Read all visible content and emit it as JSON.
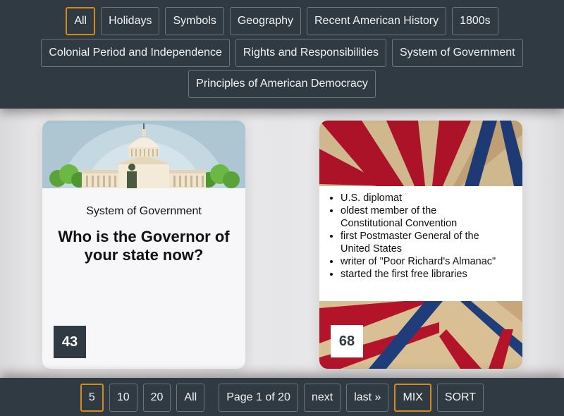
{
  "filters": {
    "row1": [
      "All",
      "Holidays",
      "Symbols",
      "Geography",
      "Recent American History",
      "1800s"
    ],
    "row2": [
      "Colonial Period and Independence",
      "Rights and Responsibilities",
      "System of Government"
    ],
    "row3": [
      "Principles of American Democracy"
    ],
    "active": "All"
  },
  "card1": {
    "category": "System of Government",
    "question": "Who is the Governor of your state now?",
    "number": "43",
    "art_icon": "capitol-building-icon"
  },
  "card2": {
    "clues": [
      "U.S. diplomat",
      "oldest member of the Constitutional Convention",
      "first Postmaster General of the United States",
      "writer of \"Poor Richard's Almanac\"",
      "started the first free libraries"
    ],
    "number": "68",
    "art_icon": "flag-sunburst-icon"
  },
  "pager": {
    "sizes": [
      "5",
      "10",
      "20",
      "All"
    ],
    "active_size": "5",
    "page_label": "Page 1 of 20",
    "next_label": "next",
    "last_label": "last »",
    "mix_label": "MIX",
    "sort_label": "SORT"
  },
  "colors": {
    "bar": "#2f3a43",
    "accent": "#d48a1c",
    "flag_red": "#b3142a",
    "flag_blue": "#1f3d7a",
    "parchment": "#d8bf94"
  }
}
